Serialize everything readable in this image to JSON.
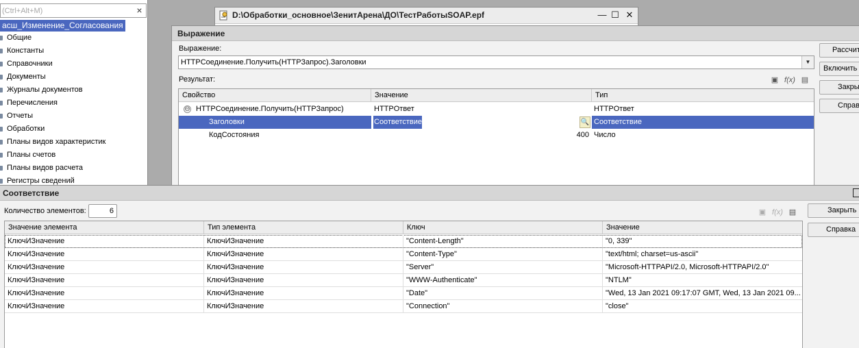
{
  "tree": {
    "search_placeholder": "(Ctrl+Alt+M)",
    "clear_label": "×",
    "root_label": "асш_Изменение_Согласования",
    "items": [
      {
        "label": "Общие"
      },
      {
        "label": "Константы"
      },
      {
        "label": "Справочники"
      },
      {
        "label": "Документы"
      },
      {
        "label": "Журналы документов"
      },
      {
        "label": "Перечисления"
      },
      {
        "label": "Отчеты"
      },
      {
        "label": "Обработки"
      },
      {
        "label": "Планы видов характеристик"
      },
      {
        "label": "Планы счетов"
      },
      {
        "label": "Планы видов расчета"
      },
      {
        "label": "Регистры сведений"
      }
    ]
  },
  "epf_window": {
    "title": "D:\\Обработки_основное\\ЗенитАрена\\ДО\\ТестРаботыSOAP.epf",
    "minimize": "—",
    "maximize": "☐",
    "close": "✕"
  },
  "expression_window": {
    "title": "Выражение",
    "expression_label": "Выражение:",
    "expression_value": "HTTPСоединение.Получить(HTTPЗапрос).Заголовки",
    "dropdown_glyph": "▼",
    "result_label": "Результат:",
    "grid": {
      "columns": [
        "Свойство",
        "Значение",
        "Тип"
      ],
      "rows": [
        {
          "property": "HTTPСоединение.Получить(HTTPЗапрос)",
          "value": "HTTPОтвет",
          "type": "HTTPОтвет",
          "toggle": "⊖"
        },
        {
          "property": "Заголовки",
          "value": "Соответствие",
          "type": "Соответствие",
          "inspect": "🔍"
        },
        {
          "property": "КодСостояния",
          "value": "400",
          "type": "Число"
        }
      ]
    },
    "buttons": {
      "calculate": "Рассчитать",
      "include": "Включить в табло",
      "close": "Закрыть",
      "help": "Справка"
    },
    "toolbar": {
      "icon1": "▣",
      "icon2": "f(x)",
      "icon3": "▤"
    }
  },
  "map_window": {
    "title": "Соответствие",
    "count_label": "Количество элементов:",
    "count_value": "6",
    "toolbar": {
      "icon1": "▣",
      "icon2": "f(x)",
      "icon3": "▤"
    },
    "buttons": {
      "close": "Закрыть",
      "help": "Справка"
    },
    "grid": {
      "columns": [
        "Значение элемента",
        "Тип элемента",
        "Ключ",
        "Значение"
      ],
      "rows": [
        {
          "element": "КлючИЗначение",
          "element_type": "КлючИЗначение",
          "key": "\"Content-Length\"",
          "value": "\"0, 339\""
        },
        {
          "element": "КлючИЗначение",
          "element_type": "КлючИЗначение",
          "key": "\"Content-Type\"",
          "value": "\"text/html; charset=us-ascii\""
        },
        {
          "element": "КлючИЗначение",
          "element_type": "КлючИЗначение",
          "key": "\"Server\"",
          "value": "\"Microsoft-HTTPAPI/2.0, Microsoft-HTTPAPI/2.0\""
        },
        {
          "element": "КлючИЗначение",
          "element_type": "КлючИЗначение",
          "key": "\"WWW-Authenticate\"",
          "value": "\"NTLM\""
        },
        {
          "element": "КлючИЗначение",
          "element_type": "КлючИЗначение",
          "key": "\"Date\"",
          "value": "\"Wed, 13 Jan 2021 09:17:07 GMT, Wed, 13 Jan 2021 09..."
        },
        {
          "element": "КлючИЗначение",
          "element_type": "КлючИЗначение",
          "key": "\"Connection\"",
          "value": "\"close\""
        }
      ]
    }
  },
  "colors": {
    "selection": "#4a67bf",
    "window_bg": "#f2f2f2",
    "titlebar_bg": "#d6d6d6",
    "desktop_bg": "#ababab"
  }
}
